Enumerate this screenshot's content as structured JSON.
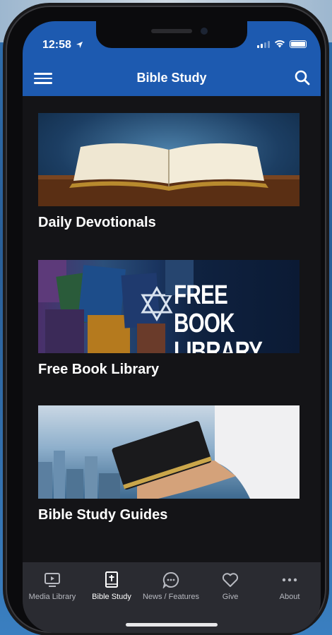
{
  "status_bar": {
    "time": "12:58"
  },
  "header": {
    "title": "Bible Study"
  },
  "cards": [
    {
      "label": "Daily Devotionals"
    },
    {
      "label": "Free Book Library",
      "image_text": [
        "FREE BOOK",
        "LIBRARY"
      ]
    },
    {
      "label": "Bible Study Guides"
    }
  ],
  "tabs": [
    {
      "label": "Media Library",
      "icon": "tv-icon"
    },
    {
      "label": "Bible Study",
      "icon": "bible-icon",
      "active": true
    },
    {
      "label": "News / Features",
      "icon": "chat-icon"
    },
    {
      "label": "Give",
      "icon": "heart-icon"
    },
    {
      "label": "About",
      "icon": "more-icon"
    }
  ],
  "colors": {
    "header": "#1d5ab0",
    "background": "#141417",
    "tabbar": "#2a2b31"
  }
}
